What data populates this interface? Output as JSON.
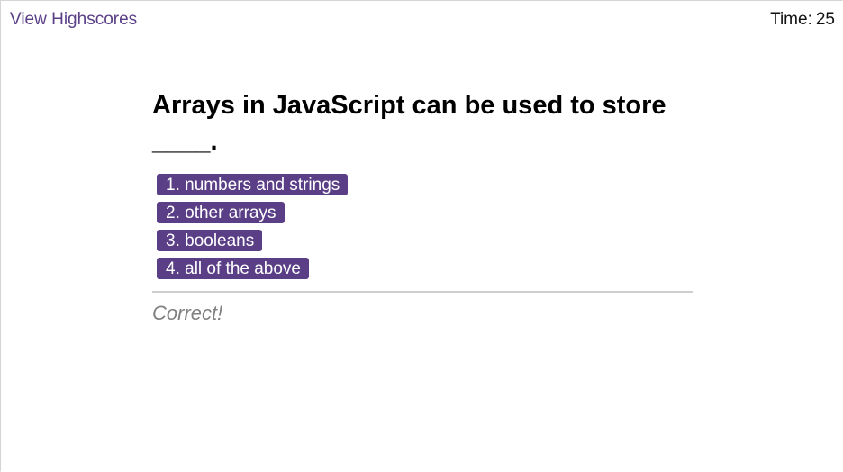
{
  "header": {
    "highscores_label": "View Highscores",
    "time_label": "Time:",
    "time_value": "25"
  },
  "quiz": {
    "question": "Arrays in JavaScript can be used to store ____.",
    "choices": [
      "1. numbers and strings",
      "2. other arrays",
      "3. booleans",
      "4. all of the above"
    ],
    "feedback": "Correct!"
  },
  "colors": {
    "accent": "#5a3f87",
    "feedback_text": "#808080",
    "divider": "#cfcfcf"
  }
}
